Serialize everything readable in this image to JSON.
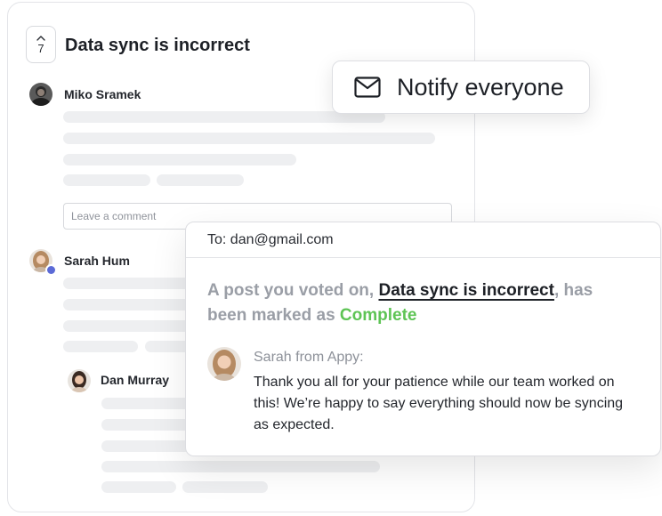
{
  "post": {
    "vote_count": "7",
    "title": "Data sync is incorrect"
  },
  "comments": [
    {
      "author": "Miko Sramek"
    },
    {
      "author": "Sarah Hum"
    },
    {
      "author": "Dan Murray"
    }
  ],
  "comment_input": {
    "placeholder": "Leave a comment"
  },
  "notify": {
    "label": "Notify everyone",
    "icon": "mail-icon"
  },
  "email": {
    "to": "To: dan@gmail.com",
    "headline_prefix": "A post you voted on, ",
    "post_link": "Data sync is incorrect",
    "headline_middle": ", has been marked as ",
    "status": "Complete",
    "sender": "Sarah from Appy:",
    "message": "Thank you all for your patience while our team worked on this! We’re happy to say everything should now be syncing as expected."
  },
  "colors": {
    "status_complete": "#5ec455",
    "admin_badge": "#5b6ad6"
  }
}
